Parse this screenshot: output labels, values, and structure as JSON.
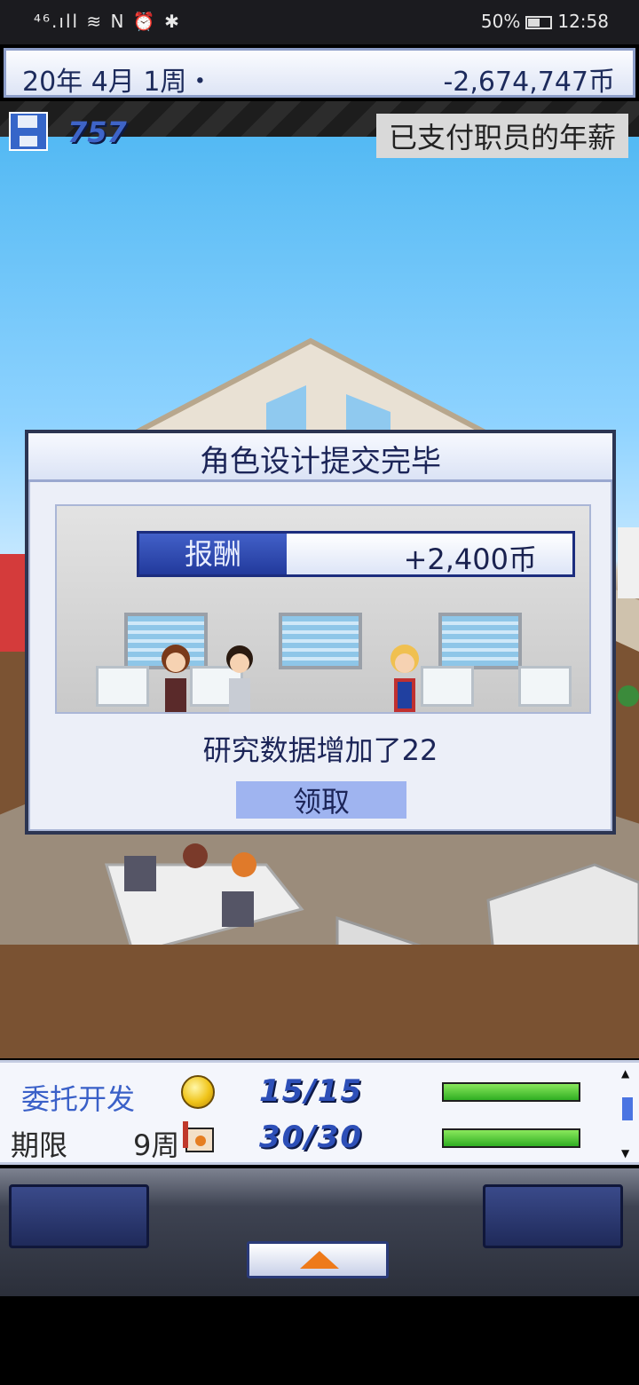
{
  "status_bar": {
    "left_text": "⁴⁶.ıll ≋ N ⏰ ✱",
    "battery": "50%",
    "time": "12:58"
  },
  "top_bar": {
    "date": "20年 4月 1周・",
    "money": "-2,674,747币"
  },
  "hud": {
    "data_count": "757",
    "notice": "已支付职员的年薪"
  },
  "dialog": {
    "title": "角色设计提交完毕",
    "reward_label": "报酬",
    "reward_value": "+2,400币",
    "message": "研究数据增加了22",
    "claim_button": "领取"
  },
  "info": {
    "job_label": "委托开发",
    "deadline_label": "期限",
    "deadline_value": "9周",
    "row1_fraction": "15/15",
    "row2_fraction": "30/30",
    "row1_progress": 1.0,
    "row2_progress": 1.0
  },
  "colors": {
    "accent_blue": "#3a60c8",
    "bar_green": "#2fae22",
    "arrow_orange": "#ee7a1a"
  }
}
